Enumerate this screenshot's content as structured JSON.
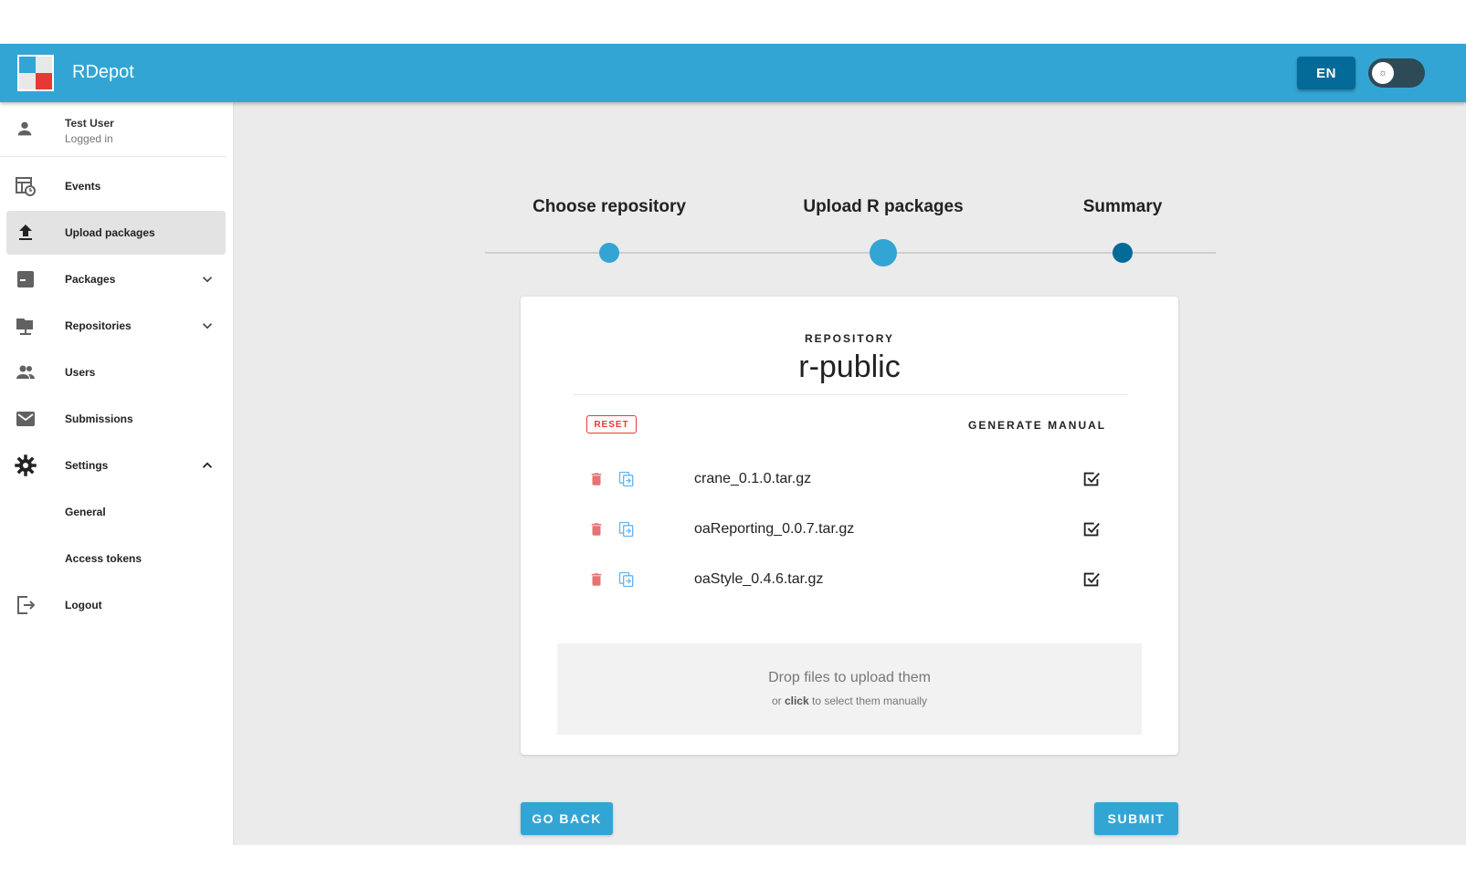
{
  "app": {
    "title": "RDepot"
  },
  "header": {
    "language": "EN",
    "theme_toggle_icon": "sun-icon"
  },
  "user": {
    "name": "Test User",
    "status": "Logged in"
  },
  "sidebar": {
    "items": [
      {
        "label": "Events",
        "icon": "events-icon"
      },
      {
        "label": "Upload packages",
        "icon": "upload-icon"
      },
      {
        "label": "Packages",
        "icon": "package-icon"
      },
      {
        "label": "Repositories",
        "icon": "repository-icon"
      },
      {
        "label": "Users",
        "icon": "users-icon"
      },
      {
        "label": "Submissions",
        "icon": "mail-icon"
      },
      {
        "label": "Settings",
        "icon": "gear-icon"
      },
      {
        "label": "General"
      },
      {
        "label": "Access tokens"
      },
      {
        "label": "Logout",
        "icon": "logout-icon"
      }
    ]
  },
  "stepper": {
    "steps": [
      {
        "label": "Choose repository"
      },
      {
        "label": "Upload R packages"
      },
      {
        "label": "Summary"
      }
    ]
  },
  "card": {
    "repository_caption": "REPOSITORY",
    "repository_name": "r-public",
    "reset_label": "RESET",
    "generate_manual_label": "GENERATE MANUAL",
    "packages": [
      {
        "name": "crane_0.1.0.tar.gz",
        "generate_manual": true
      },
      {
        "name": "oaReporting_0.0.7.tar.gz",
        "generate_manual": true
      },
      {
        "name": "oaStyle_0.4.6.tar.gz",
        "generate_manual": true
      }
    ],
    "dropzone": {
      "main": "Drop files to upload them",
      "sub_prefix": "or",
      "sub_bold": "click",
      "sub_suffix": "to select them manually"
    }
  },
  "actions": {
    "back_label": "GO BACK",
    "submit_label": "SUBMIT"
  },
  "colors": {
    "header": "#33a5d4",
    "accent": "#33a5d4",
    "step_active": "#33a5d4",
    "step_summary": "#046a97",
    "delete": "#e57373",
    "copy": "#64b5f6"
  }
}
